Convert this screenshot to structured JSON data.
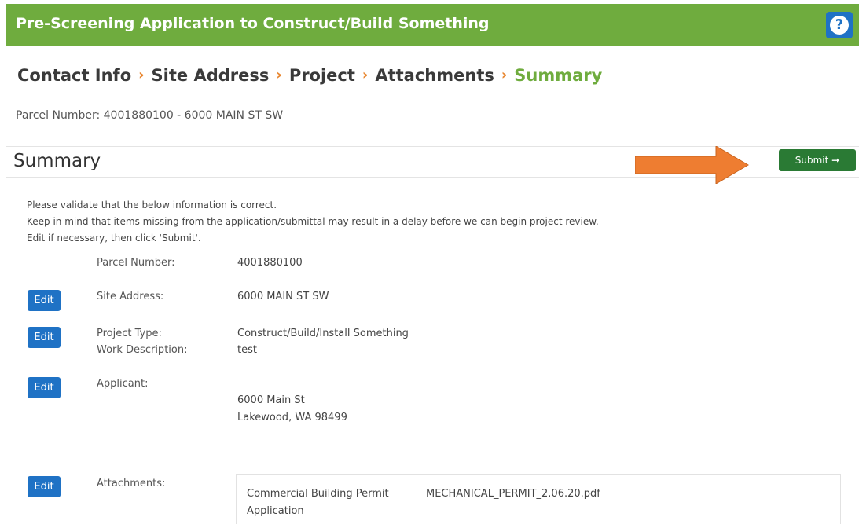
{
  "header": {
    "title": "Pre-Screening Application to Construct/Build Something",
    "help_icon": "question-icon",
    "help_symbol": "?",
    "background_color": "#6fac3e"
  },
  "breadcrumb": {
    "items": [
      {
        "label": "Contact Info"
      },
      {
        "label": "Site Address"
      },
      {
        "label": "Project"
      },
      {
        "label": "Attachments"
      },
      {
        "label": "Summary"
      }
    ],
    "separator": "›",
    "active_color": "#6fac3e",
    "separator_color": "#e8862f"
  },
  "parcel_line": "Parcel Number: 4001880100 - 6000 MAIN ST SW",
  "summary": {
    "heading": "Summary",
    "submit_label": "Submit ➞",
    "submit_color": "#2a7a34"
  },
  "instructions": [
    "Please validate that the below information is correct.",
    "Keep in mind that items missing from the application/submittal may result in a delay before we can begin project review.",
    "Edit if necessary, then click 'Submit'."
  ],
  "rows": {
    "parcel": {
      "label": "Parcel Number:",
      "value": "4001880100"
    },
    "site": {
      "label": "Site Address:",
      "value": "6000 MAIN ST SW",
      "edit_label": "Edit"
    },
    "project": {
      "type_label": "Project Type:",
      "type_value": "Construct/Build/Install Something",
      "desc_label": "Work Description:",
      "desc_value": "test",
      "edit_label": "Edit"
    },
    "applicant": {
      "label": "Applicant:",
      "address_line1": "6000 Main St",
      "address_line2": "Lakewood, WA 98499",
      "edit_label": "Edit"
    },
    "attachments": {
      "label": "Attachments:",
      "edit_label": "Edit",
      "items": [
        {
          "type": "Commercial Building Permit Application",
          "file": "MECHANICAL_PERMIT_2.06.20.pdf"
        }
      ]
    }
  },
  "edit_button_color": "#1f72c5",
  "annotation_arrow_color": "#ee7d31"
}
